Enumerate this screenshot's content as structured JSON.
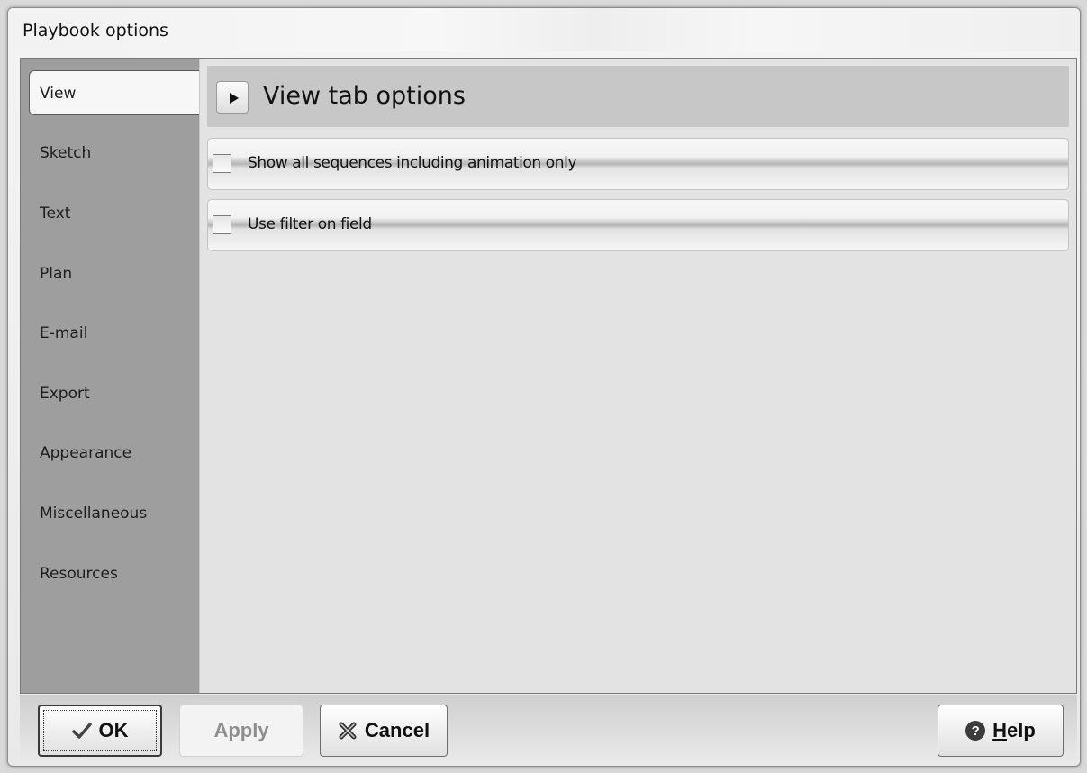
{
  "window": {
    "title": "Playbook options"
  },
  "sidebar": {
    "items": [
      {
        "label": "View",
        "active": true
      },
      {
        "label": "Sketch"
      },
      {
        "label": "Text"
      },
      {
        "label": "Plan"
      },
      {
        "label": "E-mail"
      },
      {
        "label": "Export"
      },
      {
        "label": "Appearance"
      },
      {
        "label": "Miscellaneous"
      },
      {
        "label": "Resources"
      }
    ]
  },
  "panel": {
    "title": "View tab options",
    "options": [
      {
        "label": "Show all sequences including animation only",
        "checked": false
      },
      {
        "label": "Use filter on field",
        "checked": false
      }
    ]
  },
  "footer": {
    "ok_label": "OK",
    "apply_label": "Apply",
    "cancel_label": "Cancel",
    "help_label_underlined": "H",
    "help_label_rest": "elp",
    "apply_enabled": false
  },
  "icons": {
    "expand": "expand-arrow-icon",
    "ok": "checkmark-icon",
    "cancel": "x-icon",
    "help": "question-mark-icon"
  }
}
